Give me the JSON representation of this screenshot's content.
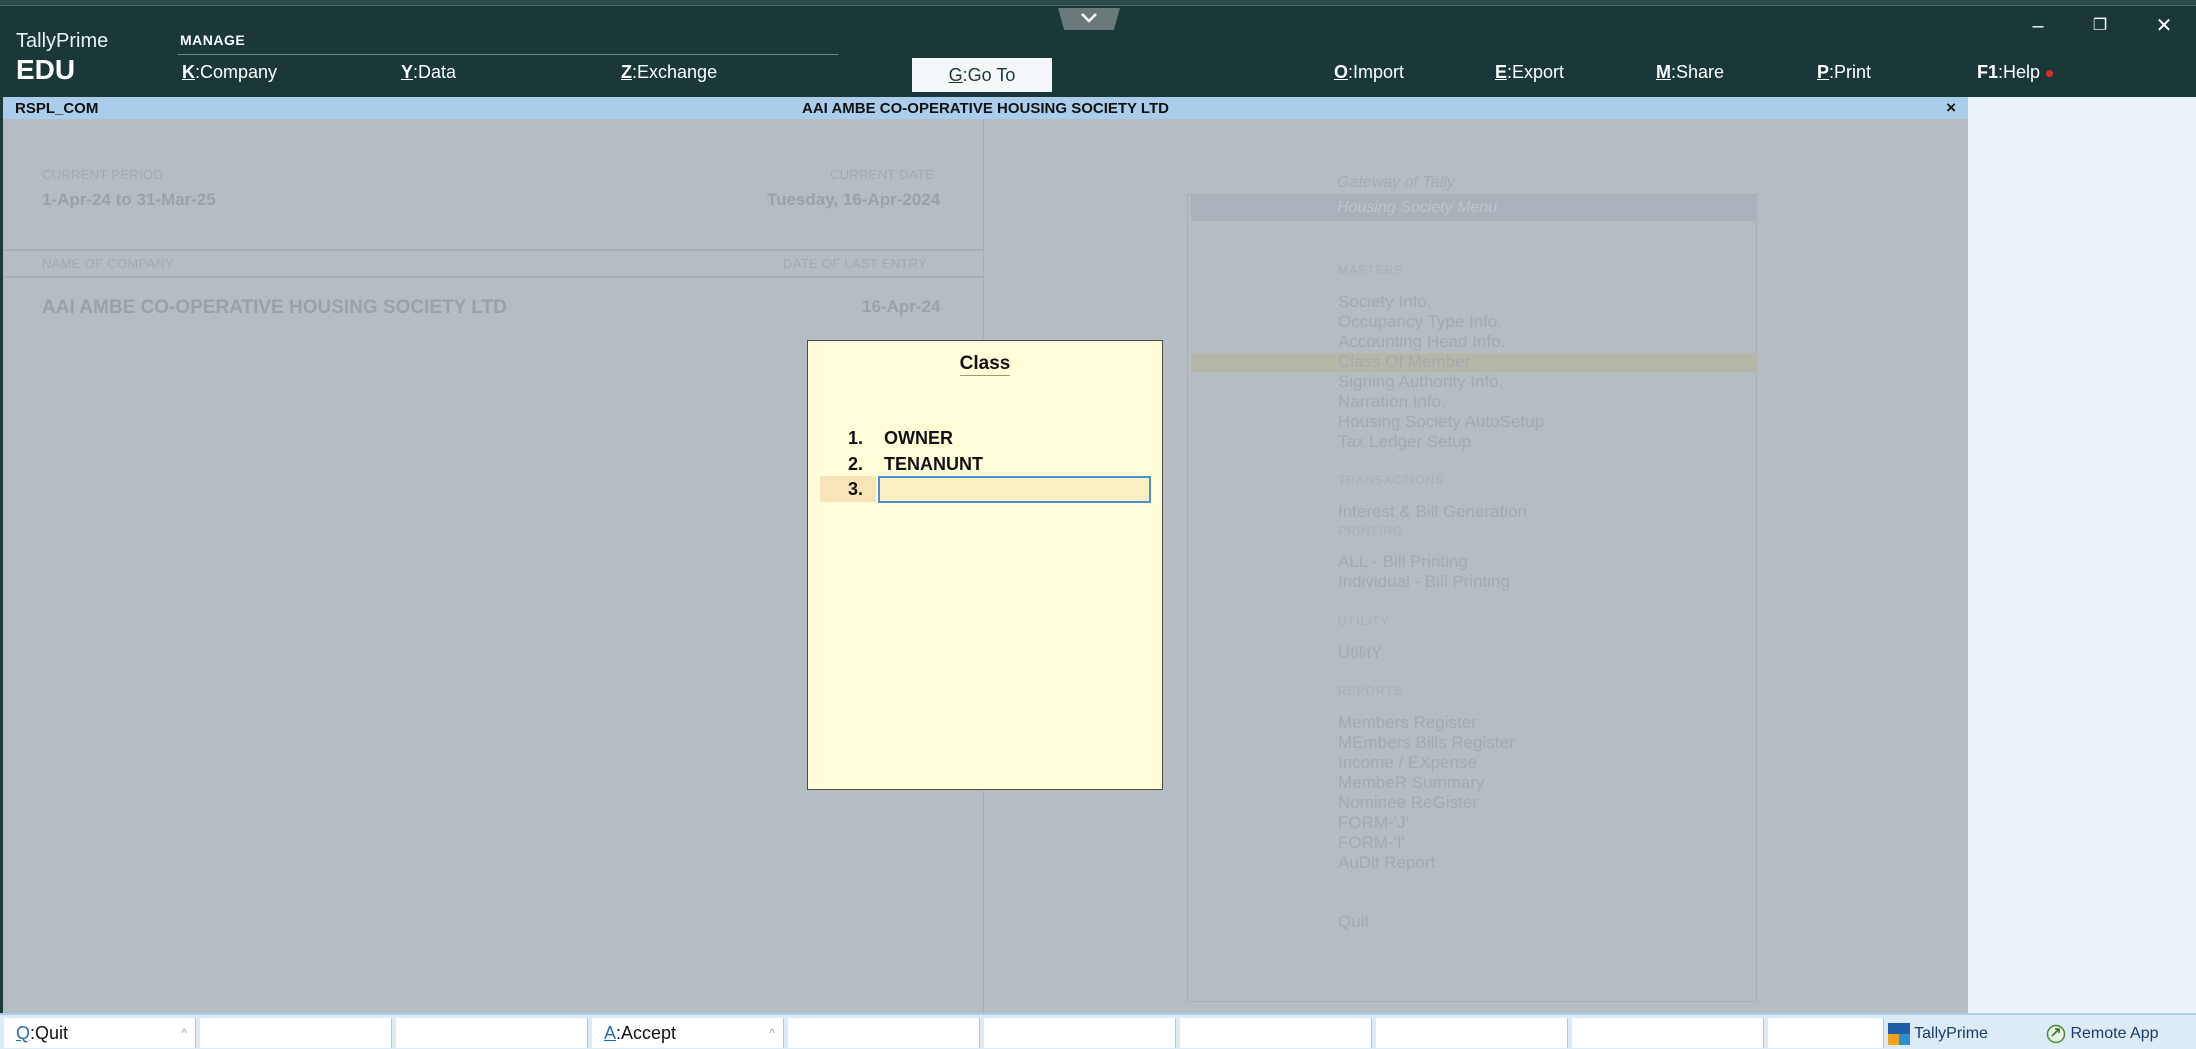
{
  "header": {
    "brand_name": "TallyPrime",
    "brand_sub": "EDU",
    "manage_label": "MANAGE",
    "menu": [
      {
        "key": "K",
        "label": "Company"
      },
      {
        "key": "Y",
        "label": "Data"
      },
      {
        "key": "Z",
        "label": "Exchange"
      },
      {
        "key": "G",
        "label": "Go To"
      },
      {
        "key": "O",
        "label": "Import"
      },
      {
        "key": "E",
        "label": "Export"
      },
      {
        "key": "M",
        "label": "Share"
      },
      {
        "key": "P",
        "label": "Print"
      },
      {
        "key": "F1",
        "label": "Help"
      }
    ],
    "window_controls": {
      "minimize": "–",
      "restore": "❐",
      "close": "✕"
    }
  },
  "titlebar": {
    "company_code": "RSPL_COM",
    "company_name": "AAI AMBE CO-OPERATIVE HOUSING SOCIETY LTD",
    "close": "×"
  },
  "company_info": {
    "current_period_label": "CURRENT PERIOD",
    "current_period": "1-Apr-24 to 31-Mar-25",
    "current_date_label": "CURRENT DATE",
    "current_date": "Tuesday, 16-Apr-2024",
    "name_label": "NAME OF COMPANY",
    "last_entry_label": "DATE OF LAST ENTRY",
    "company_name": "AAI AMBE CO-OPERATIVE HOUSING SOCIETY LTD",
    "last_entry": "16-Apr-24"
  },
  "gateway": {
    "title": "Gateway of Tally",
    "menu_title": "Housing Society Menu",
    "sections": {
      "masters": "MASTERS",
      "transactions": "TRANSACTIONS",
      "printing": "PRINTING",
      "utility": "UTILITY",
      "reports": "REPORTS"
    },
    "masters_items": [
      "Society Info.",
      "Occupancy Type Info.",
      "Accounting Head Info.",
      "Class Of Member",
      "Signing Authority Info.",
      "Narration Info.",
      "Housing Society AutoSetup",
      "Tax Ledger Setup"
    ],
    "transactions_items": [
      "Interest & Bill Generation"
    ],
    "printing_items": [
      "ALL - Bill Printing",
      "Individual - Bill Printing"
    ],
    "utility_items": [
      "UtilitY"
    ],
    "reports_items": [
      "Members Register",
      "MEmbers Bills Register",
      "Income / EXpense",
      "MembeR Summary",
      "Nominee ReGister",
      "FORM-'J'",
      "FORM-'I'",
      "AuDit Report"
    ],
    "quit": "Quit"
  },
  "class_dialog": {
    "title": "Class",
    "rows": [
      {
        "num": "1.",
        "value": "OWNER"
      },
      {
        "num": "2.",
        "value": "TENANUNT"
      }
    ],
    "active_num": "3.",
    "active_value": ""
  },
  "bottombar": {
    "quit": {
      "key": "Q",
      "label": "Quit",
      "caret": "^"
    },
    "accept": {
      "key": "A",
      "label": "Accept",
      "caret": "^"
    },
    "taskbar": {
      "tallyprime": "TallyPrime",
      "remote_app": "Remote App"
    }
  }
}
